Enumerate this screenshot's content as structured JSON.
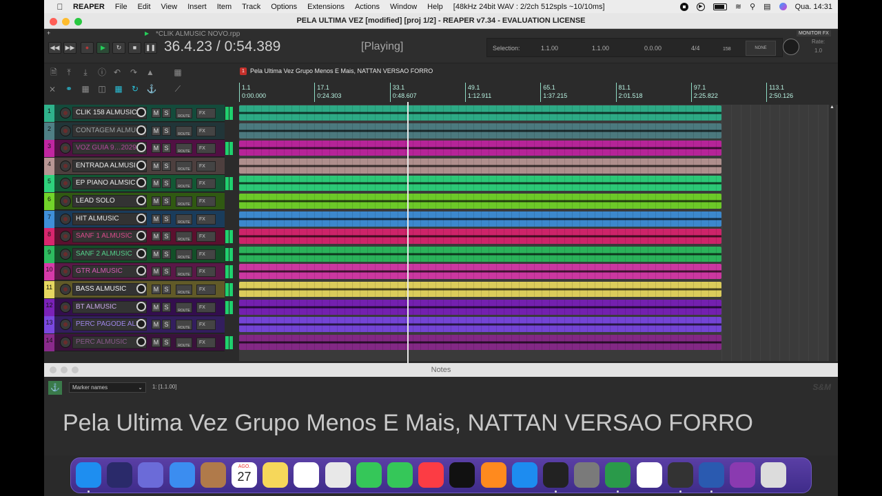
{
  "menubar": {
    "items": [
      "REAPER",
      "File",
      "Edit",
      "View",
      "Insert",
      "Item",
      "Track",
      "Options",
      "Extensions",
      "Actions",
      "Window",
      "Help"
    ],
    "audio_status": "[48kHz 24bit WAV : 2/2ch 512spls ~10/10ms]",
    "clock": "Qua.  14:31"
  },
  "window": {
    "title": "PELA ULTIMA VEZ  [modified] [proj 1/2] - REAPER v7.34 - EVALUATION LICENSE"
  },
  "transport": {
    "project_tab": "*CLIK ALMUSIC NOVO.rpp",
    "position": "36.4.23 / 0:54.389",
    "state": "[Playing]",
    "selection_label": "Selection:",
    "sel_start": "1.1.00",
    "sel_end": "1.1.00",
    "sel_len": "0.0.00",
    "time_sig": "4/4",
    "tempo": "158",
    "snap": "NONE",
    "rate_label": "Rate:",
    "rate_value": "1.0",
    "monitor_fx": "MONITOR FX"
  },
  "region": {
    "badge": "1",
    "name": "Pela Ultima Vez Grupo Menos E Mais, NATTAN VERSAO FORRO"
  },
  "ruler": {
    "markers": [
      {
        "bar": "1.1",
        "time": "0:00.000"
      },
      {
        "bar": "17.1",
        "time": "0:24.303"
      },
      {
        "bar": "33.1",
        "time": "0:48.607"
      },
      {
        "bar": "49.1",
        "time": "1:12.911"
      },
      {
        "bar": "65.1",
        "time": "1:37.215"
      },
      {
        "bar": "81.1",
        "time": "2:01.518"
      },
      {
        "bar": "97.1",
        "time": "2:25.822"
      },
      {
        "bar": "113.1",
        "time": "2:50.126"
      }
    ]
  },
  "tracks": [
    {
      "num": "1",
      "name": "CLIK 158 ALMUSIC",
      "color": "#2fb38c",
      "text": "#e8e8e8",
      "meter": true
    },
    {
      "num": "2",
      "name": "CONTAGEM  ALMU",
      "color": "#4f7f85",
      "text": "#9aa0a2",
      "meter": false
    },
    {
      "num": "3",
      "name": "VOZ GUIA  9…2029",
      "color": "#c026a0",
      "text": "#b24a9c",
      "meter": true
    },
    {
      "num": "4",
      "name": "ENTRADA ALMUSI",
      "color": "#b89694",
      "text": "#e8e8e8",
      "meter": false
    },
    {
      "num": "5",
      "name": "EP PIANO ALMSIC",
      "color": "#2ed27c",
      "text": "#e8e8e8",
      "meter": true
    },
    {
      "num": "6",
      "name": "LEAD SOLO",
      "color": "#72d42a",
      "text": "#e8e8e8",
      "meter": false
    },
    {
      "num": "7",
      "name": "HIT ALMUSIC",
      "color": "#3f8fd8",
      "text": "#e8e8e8",
      "meter": false
    },
    {
      "num": "8",
      "name": "SANF 1 ALMUSIC",
      "color": "#d8266e",
      "text": "#d84c8a",
      "meter": true
    },
    {
      "num": "9",
      "name": "SANF 2 ALMUSIC",
      "color": "#2dbb5f",
      "text": "#54d08a",
      "meter": true
    },
    {
      "num": "10",
      "name": "GTR ALMUSIC",
      "color": "#d63aa8",
      "text": "#d85cb6",
      "meter": true
    },
    {
      "num": "11",
      "name": "BASS ALMUSIC",
      "color": "#e6d760",
      "text": "#f0f0f0",
      "meter": true
    },
    {
      "num": "12",
      "name": "BT ALMUSIC",
      "color": "#7a22b8",
      "text": "#c8a8e6",
      "meter": true
    },
    {
      "num": "13",
      "name": "PERC PAGODE ALI",
      "color": "#7a48e0",
      "text": "#9e86e8",
      "meter": false
    },
    {
      "num": "14",
      "name": "PERC ALMUSIC",
      "color": "#8a2a8c",
      "text": "#8a5a8c",
      "meter": true
    }
  ],
  "track_buttons": {
    "mute": "M",
    "solo": "S",
    "route": "ROUTE",
    "fx": "FX"
  },
  "notes": {
    "title": "Notes",
    "dropdown": "Marker names",
    "position": "1: [1.1.00]",
    "tag": "S&M",
    "text": "Pela Ultima Vez Grupo Menos E Mais, NATTAN VERSAO FORRO"
  },
  "dock": {
    "calendar_month": "AGO.",
    "calendar_day": "27",
    "apps": [
      "finder-icon",
      "siri-icon",
      "launchpad-icon",
      "mail-icon",
      "contacts-icon",
      "calendar-icon",
      "notes-icon",
      "reminders-icon",
      "maps-icon",
      "messages-icon",
      "facetime-icon",
      "music-icon",
      "appletv-icon",
      "books-icon",
      "appstore-icon",
      "piano-icon",
      "settings-icon",
      "reaper-icon",
      "chrome-icon",
      "calculator-icon",
      "quicktime-icon",
      "notebook-icon",
      "trash-icon"
    ]
  }
}
